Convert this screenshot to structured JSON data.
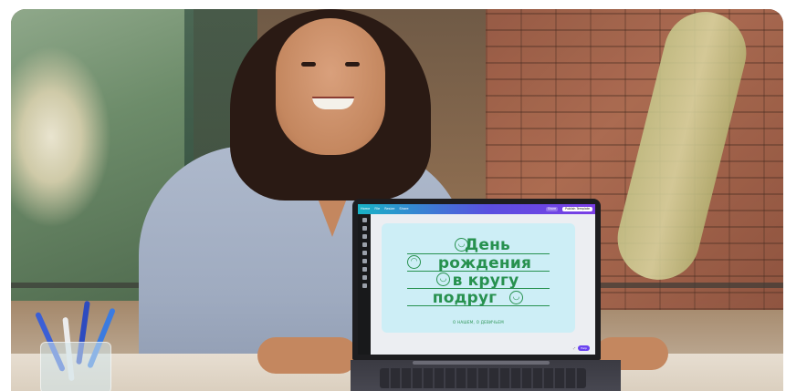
{
  "laptop_editor": {
    "topbar": {
      "menu_items": [
        "Home",
        "File",
        "Resize",
        "Share"
      ],
      "pills": [
        "Share",
        "Publish Template"
      ]
    },
    "design_card": {
      "title_lines": [
        "День",
        "рождения",
        "в кругу",
        "подруг"
      ],
      "subtitle": "О НАШЕМ, О ДЕВИЧЬЕМ",
      "accent_color": "#27914f",
      "background_color": "#cdeef6"
    },
    "bottom_tools": {
      "help_label": "Help"
    }
  }
}
